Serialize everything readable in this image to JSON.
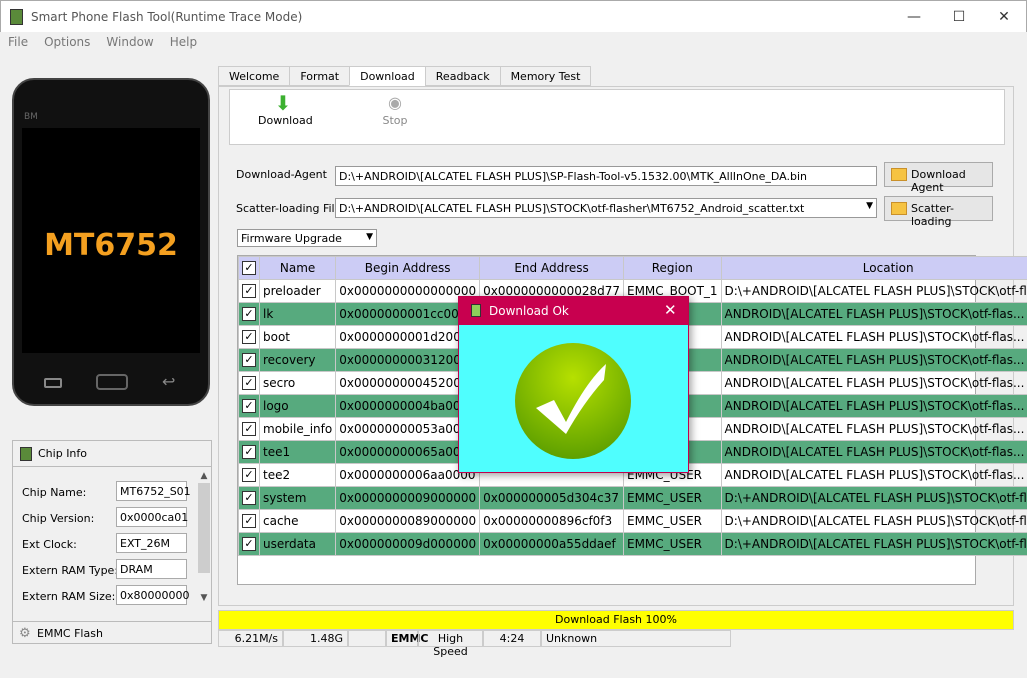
{
  "window": {
    "title": "Smart Phone Flash Tool(Runtime Trace Mode)",
    "minimize": "—",
    "maximize": "☐",
    "close": "✕"
  },
  "menu": [
    "File",
    "Options",
    "Window",
    "Help"
  ],
  "phone": {
    "chip_label": "MT6752",
    "brand": "BM"
  },
  "chip_info": {
    "title": "Chip Info",
    "fields": [
      {
        "label": "Chip Name:",
        "value": "MT6752_S01"
      },
      {
        "label": "Chip Version:",
        "value": "0x0000ca01"
      },
      {
        "label": "Ext Clock:",
        "value": "EXT_26M"
      },
      {
        "label": "Extern RAM Type:",
        "value": "DRAM"
      },
      {
        "label": "Extern RAM Size:",
        "value": "0x80000000"
      }
    ],
    "footer": "EMMC Flash"
  },
  "tabs": [
    "Welcome",
    "Format",
    "Download",
    "Readback",
    "Memory Test"
  ],
  "active_tab": "Download",
  "toolbar": {
    "download": "Download",
    "stop": "Stop"
  },
  "download_agent": {
    "label": "Download-Agent",
    "value": "D:\\+ANDROID\\[ALCATEL FLASH PLUS]\\SP-Flash-Tool-v5.1532.00\\MTK_AllInOne_DA.bin",
    "button": "Download Agent"
  },
  "scatter": {
    "label": "Scatter-loading File",
    "value": "D:\\+ANDROID\\[ALCATEL FLASH PLUS]\\STOCK\\otf-flasher\\MT6752_Android_scatter.txt",
    "button": "Scatter-loading"
  },
  "mode": {
    "value": "Firmware Upgrade"
  },
  "table": {
    "columns": [
      "Name",
      "Begin Address",
      "End Address",
      "Region",
      "Location"
    ],
    "rows": [
      {
        "name": "preloader",
        "begin": "0x0000000000000000",
        "end": "0x0000000000028d77",
        "region": "EMMC_BOOT_1",
        "location": "D:\\+ANDROID\\[ALCATEL FLASH PLUS]\\STOCK\\otf-flas..."
      },
      {
        "name": "lk",
        "begin": "0x0000000001cc0000",
        "end": "",
        "region": "",
        "location": "ANDROID\\[ALCATEL FLASH PLUS]\\STOCK\\otf-flas..."
      },
      {
        "name": "boot",
        "begin": "0x0000000001d20000",
        "end": "",
        "region": "",
        "location": "ANDROID\\[ALCATEL FLASH PLUS]\\STOCK\\otf-flas..."
      },
      {
        "name": "recovery",
        "begin": "0x0000000003120000",
        "end": "",
        "region": "",
        "location": "ANDROID\\[ALCATEL FLASH PLUS]\\STOCK\\otf-flas..."
      },
      {
        "name": "secro",
        "begin": "0x0000000004520000",
        "end": "",
        "region": "",
        "location": "ANDROID\\[ALCATEL FLASH PLUS]\\STOCK\\otf-flas..."
      },
      {
        "name": "logo",
        "begin": "0x0000000004ba0000",
        "end": "",
        "region": "",
        "location": "ANDROID\\[ALCATEL FLASH PLUS]\\STOCK\\otf-flas..."
      },
      {
        "name": "mobile_info",
        "begin": "0x00000000053a0000",
        "end": "",
        "region": "",
        "location": "ANDROID\\[ALCATEL FLASH PLUS]\\STOCK\\otf-flas..."
      },
      {
        "name": "tee1",
        "begin": "0x00000000065a0000",
        "end": "",
        "region": "",
        "location": "ANDROID\\[ALCATEL FLASH PLUS]\\STOCK\\otf-flas..."
      },
      {
        "name": "tee2",
        "begin": "0x0000000006aa0000",
        "end": "",
        "region": "EMMC_USER",
        "location": "ANDROID\\[ALCATEL FLASH PLUS]\\STOCK\\otf-flas..."
      },
      {
        "name": "system",
        "begin": "0x0000000009000000",
        "end": "0x000000005d304c37",
        "region": "EMMC_USER",
        "location": "D:\\+ANDROID\\[ALCATEL FLASH PLUS]\\STOCK\\otf-flas..."
      },
      {
        "name": "cache",
        "begin": "0x0000000089000000",
        "end": "0x00000000896cf0f3",
        "region": "EMMC_USER",
        "location": "D:\\+ANDROID\\[ALCATEL FLASH PLUS]\\STOCK\\otf-flas..."
      },
      {
        "name": "userdata",
        "begin": "0x000000009d000000",
        "end": "0x00000000a55ddaef",
        "region": "EMMC_USER",
        "location": "D:\\+ANDROID\\[ALCATEL FLASH PLUS]\\STOCK\\otf-flas..."
      }
    ]
  },
  "dialog": {
    "title": "Download Ok",
    "close": "✕"
  },
  "status": {
    "progress_label": "Download Flash 100%",
    "progress": 100,
    "speed": "6.21M/s",
    "size": "1.48G",
    "blank": "",
    "storage": "EMMC",
    "usb": "High Speed",
    "time": "4:24",
    "info": "Unknown"
  },
  "colors": {
    "progress": "#ffff00",
    "row_alt": "#57aa7e",
    "header": "#ccccf5",
    "dialog_title": "#c8004f",
    "dialog_body": "#4ffefe"
  }
}
